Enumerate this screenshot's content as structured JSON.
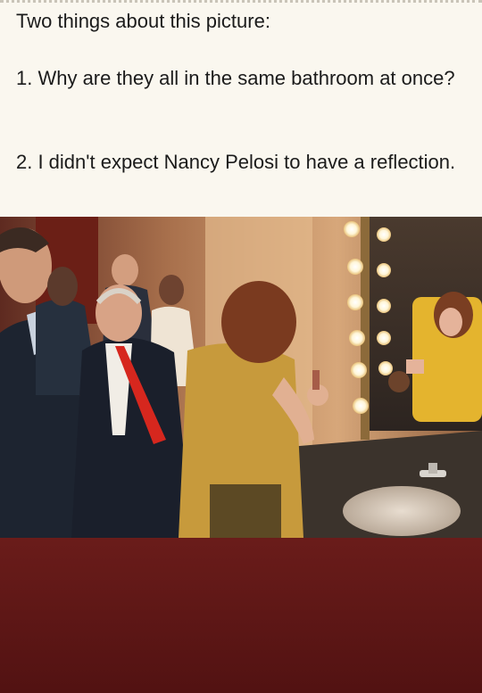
{
  "caption": {
    "line1": "Two things about this picture:",
    "line2": "1. Why are they all in the same bathroom at once?",
    "line3": "2. I didn't expect Nancy Pelosi to have a reflection."
  },
  "photo": {
    "subject": "people in a bathroom, one woman at the mirror"
  },
  "colors": {
    "caption_bg": "#faf7ef",
    "page_bg": "#5a1414",
    "tie_red": "#d6271e",
    "top_mustard": "#c79a3c"
  }
}
